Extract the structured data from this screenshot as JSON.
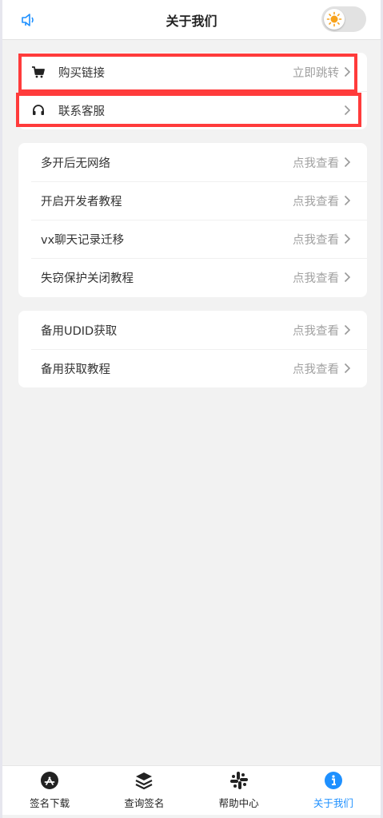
{
  "header": {
    "title": "关于我们"
  },
  "colors": {
    "accent": "#1e90ff",
    "highlight": "#ff3b3b",
    "sun": "#f7a21b"
  },
  "purchase_card": {
    "items": [
      {
        "label": "购买链接",
        "action": "立即跳转",
        "icon": "cart-icon"
      },
      {
        "label": "联系客服",
        "action": "",
        "icon": "headset-icon"
      }
    ]
  },
  "guides_card": {
    "items": [
      {
        "label": "多开后无网络",
        "action": "点我查看"
      },
      {
        "label": "开启开发者教程",
        "action": "点我查看"
      },
      {
        "label": "vx聊天记录迁移",
        "action": "点我查看"
      },
      {
        "label": "失窃保护关闭教程",
        "action": "点我查看"
      }
    ]
  },
  "udid_card": {
    "items": [
      {
        "label": "备用UDID获取",
        "action": "点我查看"
      },
      {
        "label": "备用获取教程",
        "action": "点我查看"
      }
    ]
  },
  "tabbar": {
    "tabs": [
      {
        "label": "签名下载",
        "icon": "app-store-icon"
      },
      {
        "label": "查询签名",
        "icon": "layers-icon"
      },
      {
        "label": "帮助中心",
        "icon": "slack-icon"
      },
      {
        "label": "关于我们",
        "icon": "info-icon",
        "active": true
      }
    ]
  }
}
